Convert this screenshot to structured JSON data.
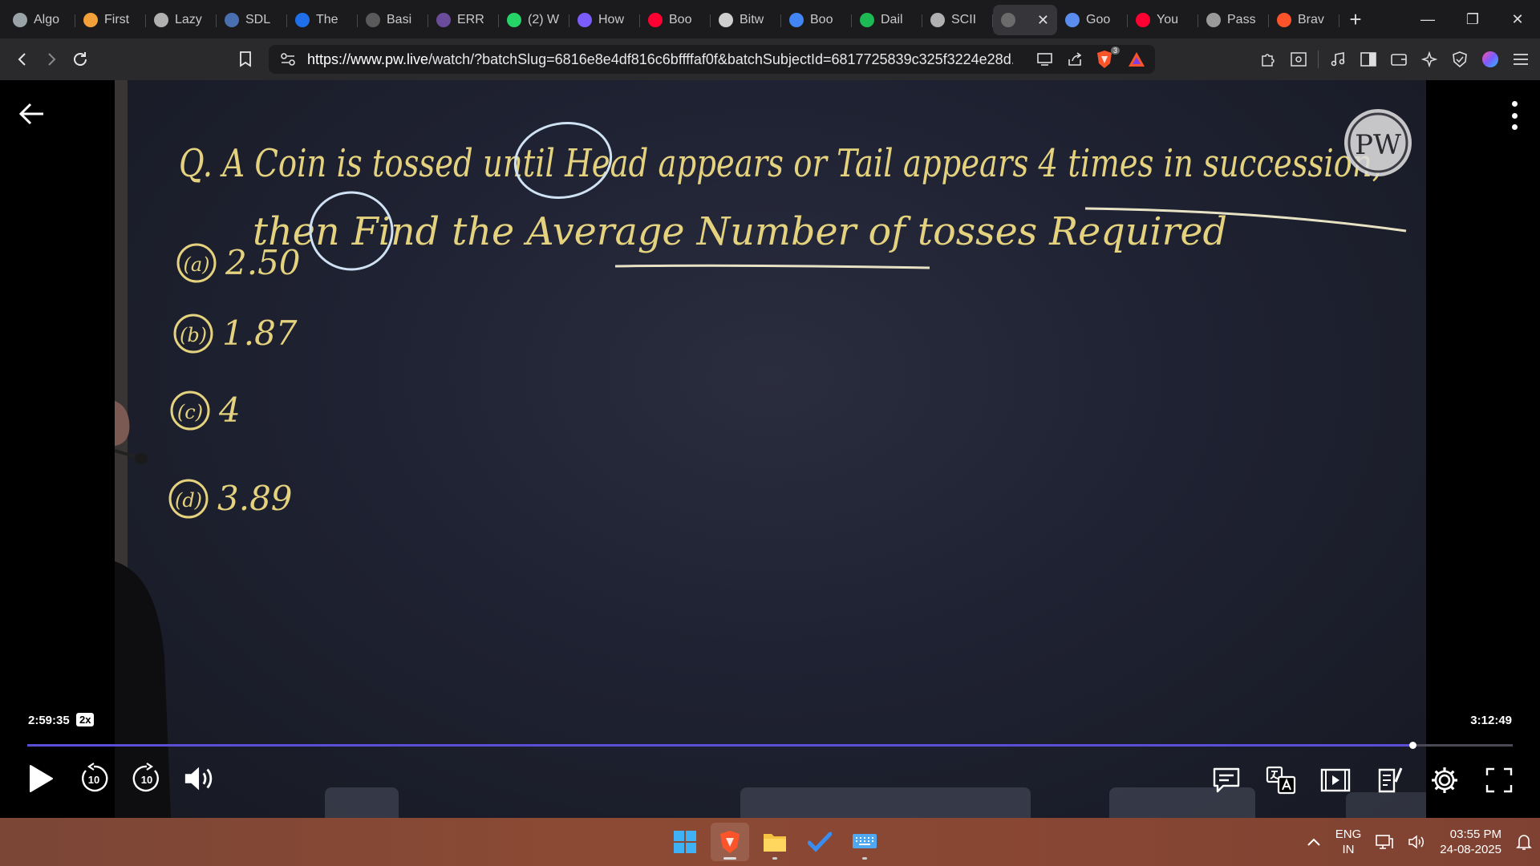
{
  "browser": {
    "tabs": [
      {
        "label": "Algo",
        "icon": "chatgpt-icon",
        "color": "#9aa3a8"
      },
      {
        "label": "First",
        "icon": "bolt-icon",
        "color": "#f2a13a"
      },
      {
        "label": "Lazy",
        "icon": "globe-icon",
        "color": "#b0b0b0"
      },
      {
        "label": "SDL",
        "icon": "image-icon",
        "color": "#4a6fb0"
      },
      {
        "label": "The",
        "icon": "w3schools-icon",
        "color": "#1f6feb"
      },
      {
        "label": "Basi",
        "icon": "tile-icon",
        "color": "#5a5a5a"
      },
      {
        "label": "ERR",
        "icon": "avatar-icon",
        "color": "#6b4c9a"
      },
      {
        "label": "(2) W",
        "icon": "whatsapp-icon",
        "color": "#25d366"
      },
      {
        "label": "How",
        "icon": "bookmark-icon",
        "color": "#7b5cff"
      },
      {
        "label": "Boo",
        "icon": "youtube-icon",
        "color": "#ff0033"
      },
      {
        "label": "Bitw",
        "icon": "bitwise-icon",
        "color": "#cfcfcf"
      },
      {
        "label": "Boo",
        "icon": "google-icon",
        "color": "#4285f4"
      },
      {
        "label": "Dail",
        "icon": "spotify-icon",
        "color": "#1db954"
      },
      {
        "label": "SCII",
        "icon": "globe-icon",
        "color": "#b0b0b0"
      },
      {
        "label": "",
        "icon": "globe-icon",
        "color": "#6b6b6b",
        "active": true
      },
      {
        "label": "Goo",
        "icon": "gemini-icon",
        "color": "#5b8def"
      },
      {
        "label": "You",
        "icon": "youtube-icon",
        "color": "#ff0033"
      },
      {
        "label": "Pass",
        "icon": "key-icon",
        "color": "#9a9a9a"
      },
      {
        "label": "Brav",
        "icon": "brave-icon",
        "color": "#fb542b"
      }
    ],
    "url_host": "https://www.pw.live",
    "url_path": "/watch/?batchSlug=6816e8e4df816c6bffffaf0f&batchSubjectId=6817725839c325f3224e28d...",
    "shields_badge": "3"
  },
  "board": {
    "question_line1": "Q. A Coin is tossed until Head appears or Tail appears 4 times in succession,",
    "question_line2": "then Find the Average Number of tosses Required",
    "options": [
      {
        "label": "(a)",
        "value": "2.50"
      },
      {
        "label": "(b)",
        "value": "1.87"
      },
      {
        "label": "(c)",
        "value": "4"
      },
      {
        "label": "(d)",
        "value": "3.89"
      }
    ],
    "logo_text": "PW"
  },
  "player": {
    "current_time": "2:59:35",
    "speed": "2x",
    "total_time": "3:12:49",
    "progress": 0.9323,
    "skip_back": "10",
    "skip_forward": "10"
  },
  "taskbar": {
    "lang_top": "ENG",
    "lang_bottom": "IN",
    "time": "03:55 PM",
    "date": "24-08-2025"
  }
}
